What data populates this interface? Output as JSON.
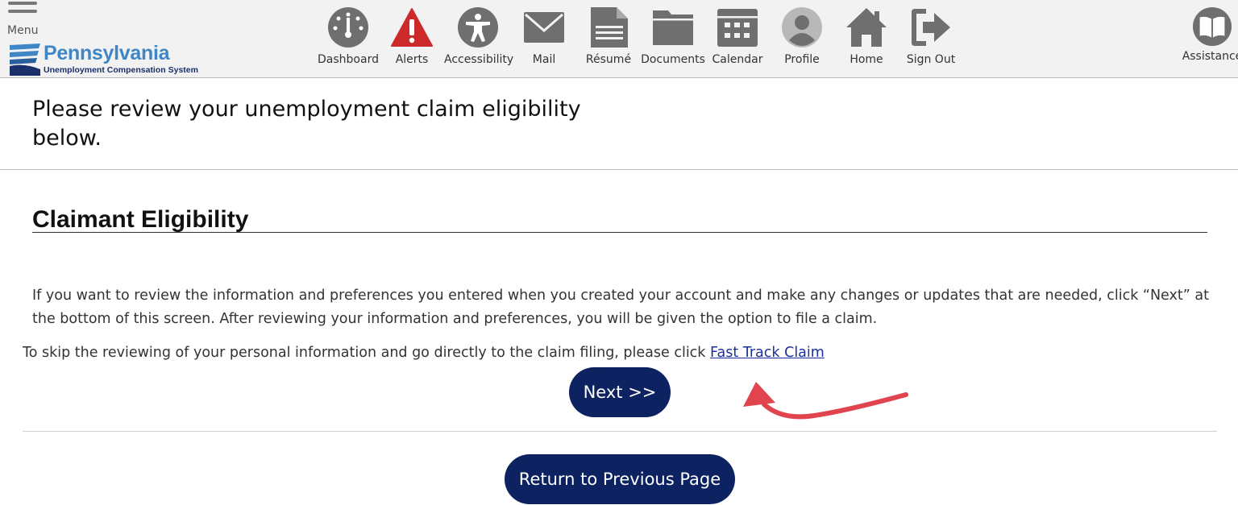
{
  "header": {
    "menu_label": "Menu",
    "logo": {
      "name": "Pennsylvania",
      "subtitle": "Unemployment Compensation System"
    },
    "nav": [
      {
        "label": "Dashboard",
        "icon": "dashboard-gauge-icon"
      },
      {
        "label": "Alerts",
        "icon": "alert-warning-icon"
      },
      {
        "label": "Accessibility",
        "icon": "accessibility-person-icon"
      },
      {
        "label": "Mail",
        "icon": "mail-envelope-icon"
      },
      {
        "label": "Résumé",
        "icon": "resume-document-icon"
      },
      {
        "label": "Documents",
        "icon": "documents-folder-icon"
      },
      {
        "label": "Calendar",
        "icon": "calendar-icon"
      },
      {
        "label": "Profile",
        "icon": "profile-avatar-icon"
      },
      {
        "label": "Home",
        "icon": "home-house-icon"
      },
      {
        "label": "Sign Out",
        "icon": "sign-out-icon"
      },
      {
        "label": "Assistance",
        "icon": "assistance-book-icon"
      }
    ]
  },
  "page": {
    "title": "Please review your unemployment claim eligibility below.",
    "section_title": "Claimant Eligibility",
    "paragraph": "If you want to review the information and preferences you entered when you created your account and make any changes or updates that are needed, click “Next” at the bottom of this screen. After reviewing your information and preferences, you will be given the option to file a claim.",
    "skip_text": "To skip the reviewing of your personal information and go directly to the claim filing, please click ",
    "fast_track_link": "Fast Track Claim",
    "next_button": "Next >>",
    "return_button": "Return to Previous Page"
  },
  "colors": {
    "button_navy": "#0d2260",
    "link_blue": "#1c2fa0",
    "arrow_red": "#e0444e",
    "alert_red": "#cc2a2a",
    "icon_gray": "#6f6f6f"
  }
}
